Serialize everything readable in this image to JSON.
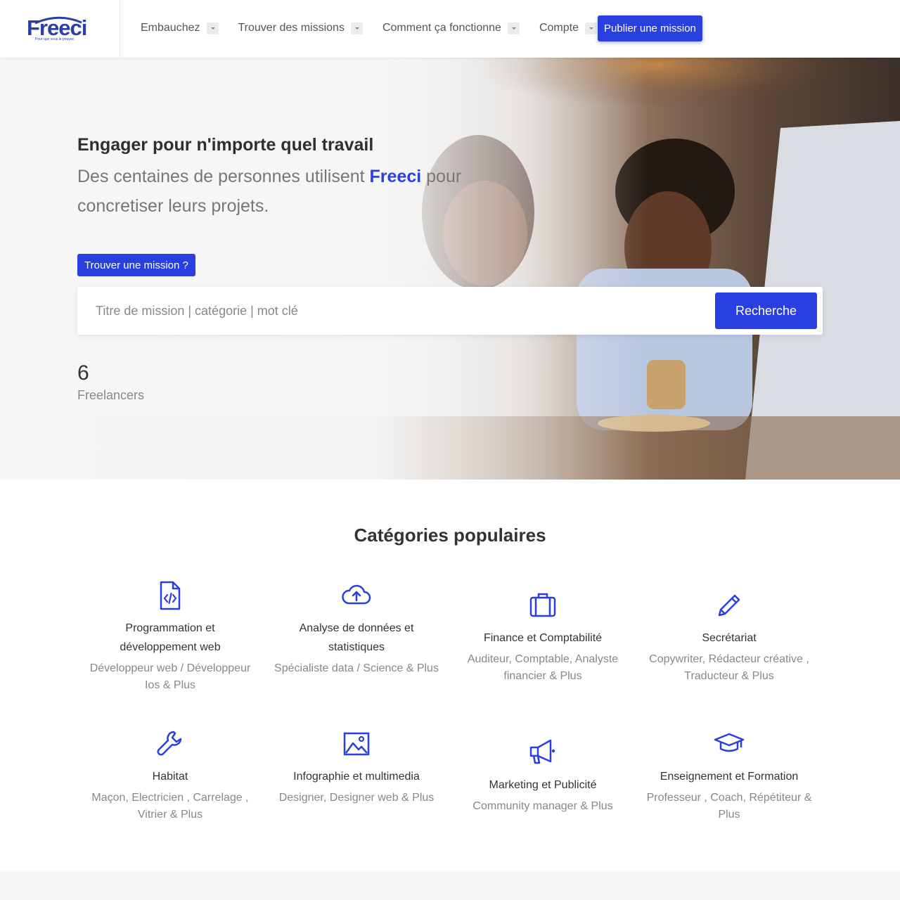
{
  "header": {
    "logo": {
      "text": "Freeci",
      "tagline": "Pour que vous le pouvez"
    },
    "nav": [
      {
        "label": "Embauchez"
      },
      {
        "label": "Trouver des missions"
      },
      {
        "label": "Comment ça fonctionne"
      },
      {
        "label": "Compte"
      }
    ],
    "publish_label": "Publier une mission"
  },
  "hero": {
    "title": "Engager pour n'importe quel travail",
    "subtitle_before": "Des centaines de personnes utilisent ",
    "subtitle_brand": "Freeci",
    "subtitle_after": " pour concretiser leurs projets.",
    "find_label": "Trouver une mission ?",
    "search": {
      "placeholder": "Titre de mission | catégorie | mot clé",
      "value": "",
      "button": "Recherche"
    },
    "stat": {
      "value": "6",
      "label": "Freelancers"
    }
  },
  "categories": {
    "title": "Catégories populaires",
    "items": [
      {
        "icon": "code-file-icon",
        "name": "Programmation et développement web",
        "desc": "Développeur web / Développeur Ios & Plus"
      },
      {
        "icon": "cloud-upload-icon",
        "name": "Analyse de données et statistiques",
        "desc": "Spécialiste data / Science & Plus"
      },
      {
        "icon": "briefcase-icon",
        "name": "Finance et Comptabilité",
        "desc": "Auditeur, Comptable, Analyste financier & Plus"
      },
      {
        "icon": "pencil-icon",
        "name": "Secrétariat",
        "desc": "Copywriter, Rédacteur créative , Traducteur & Plus"
      },
      {
        "icon": "wrench-icon",
        "name": "Habitat",
        "desc": "Maçon, Electricien , Carrelage , Vitrier & Plus"
      },
      {
        "icon": "image-icon",
        "name": "Infographie et multimedia",
        "desc": "Designer, Designer web & Plus"
      },
      {
        "icon": "megaphone-icon",
        "name": "Marketing et Publicité",
        "desc": "Community manager & Plus"
      },
      {
        "icon": "graduation-cap-icon",
        "name": "Enseignement et Formation",
        "desc": "Professeur , Coach, Répétiteur & Plus"
      }
    ]
  },
  "colors": {
    "accent": "#2a3fe0",
    "logo": "#2b3fa8",
    "muted": "#888888",
    "hero_bg": "#f4f4f4"
  }
}
